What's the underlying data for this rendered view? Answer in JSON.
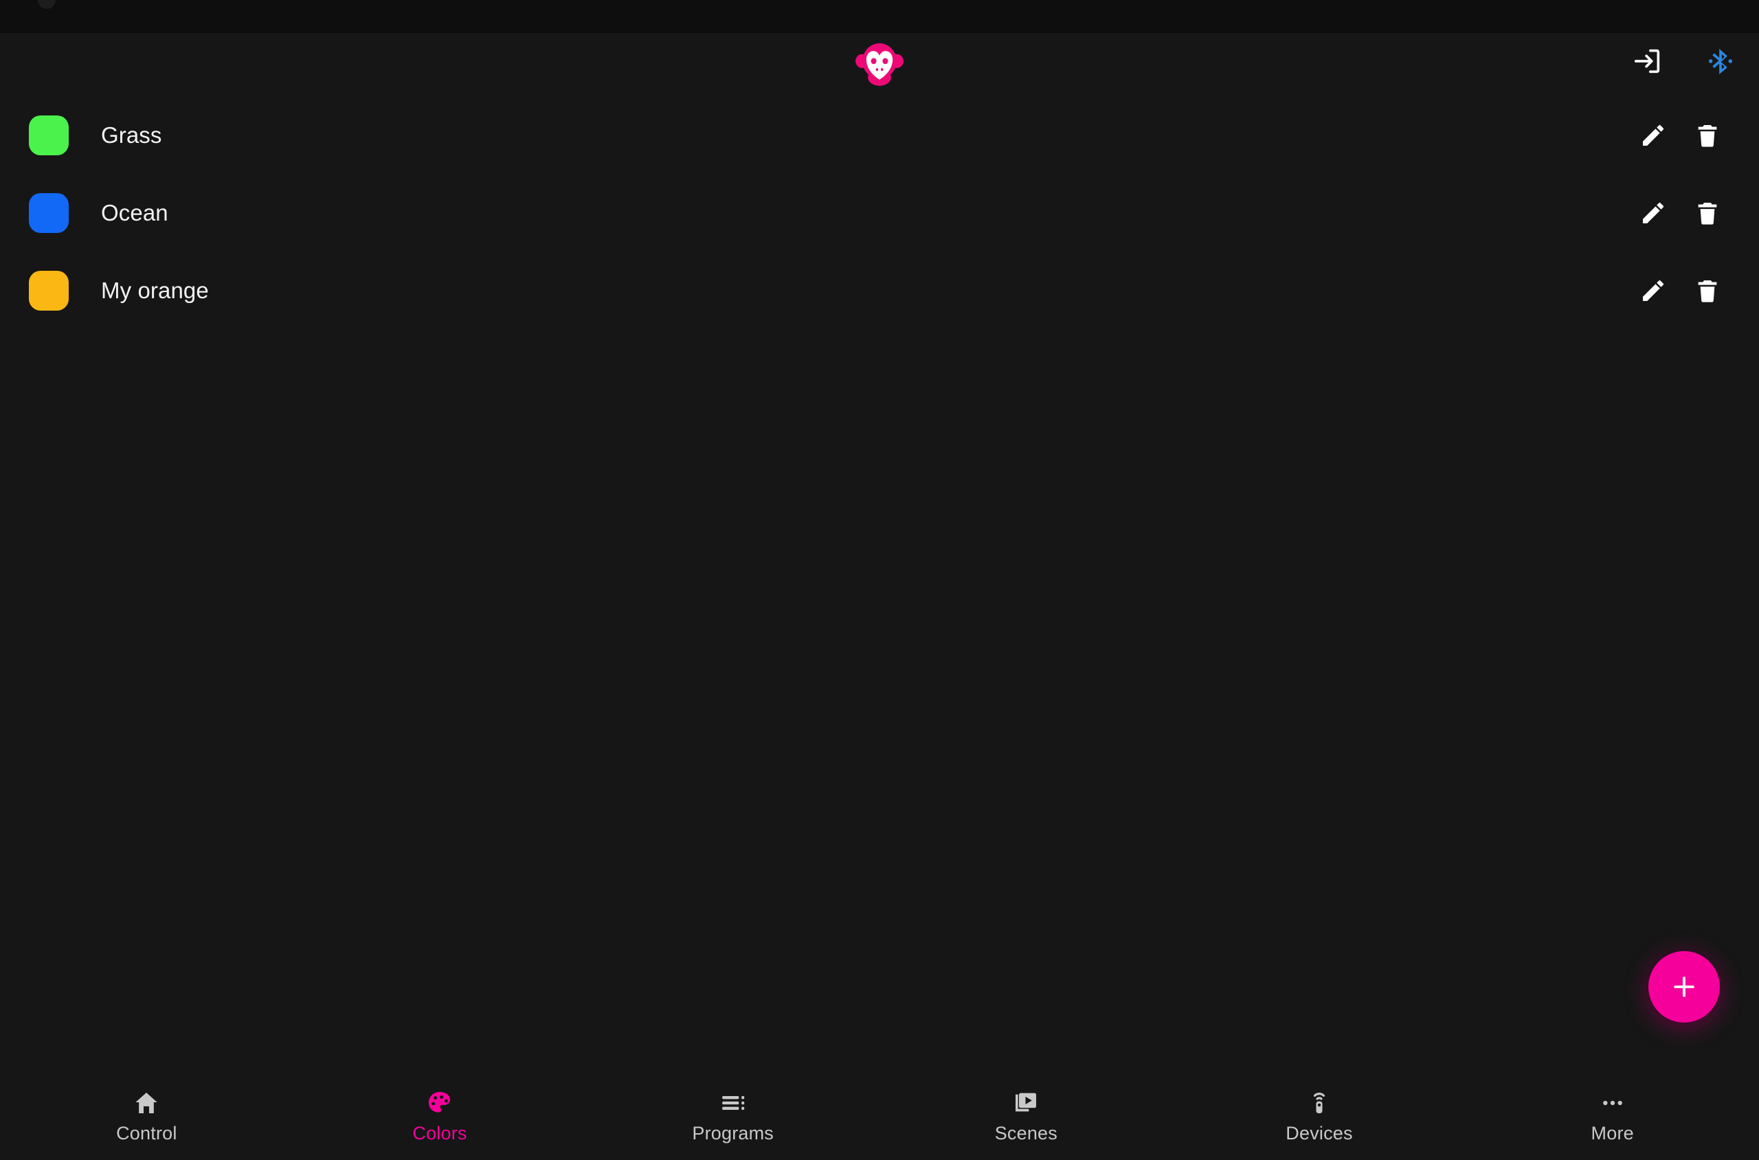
{
  "theme": {
    "background": "#161616",
    "status_bar_background": "#0E0E0E",
    "accent_pink": "#F5009B",
    "bluetooth_blue": "#2B87E3",
    "text_primary": "#F2F2F2",
    "text_nav": "#C9C9C9"
  },
  "appbar": {
    "logo_name": "monkey-logo",
    "logo_color": "#ED0A77",
    "actions": [
      {
        "name": "login-icon",
        "label": "Login"
      },
      {
        "name": "bluetooth-icon",
        "label": "Bluetooth"
      }
    ]
  },
  "colors_screen": {
    "rows": [
      {
        "name": "Grass",
        "swatch": "#4CF24C",
        "edit_label": "Edit",
        "delete_label": "Delete"
      },
      {
        "name": "Ocean",
        "swatch": "#1169F5",
        "edit_label": "Edit",
        "delete_label": "Delete"
      },
      {
        "name": "My orange",
        "swatch": "#FBB713",
        "edit_label": "Edit",
        "delete_label": "Delete"
      }
    ],
    "fab": {
      "label": "+",
      "name": "add-color-button",
      "color": "#F5009B"
    }
  },
  "bottom_nav": {
    "items": [
      {
        "label": "Control",
        "icon": "home-icon",
        "active": false
      },
      {
        "label": "Colors",
        "icon": "palette-icon",
        "active": true
      },
      {
        "label": "Programs",
        "icon": "playlist-icon",
        "active": false
      },
      {
        "label": "Scenes",
        "icon": "slideshow-icon",
        "active": false
      },
      {
        "label": "Devices",
        "icon": "remote-icon",
        "active": false
      },
      {
        "label": "More",
        "icon": "ellipsis-icon",
        "active": false
      }
    ]
  }
}
